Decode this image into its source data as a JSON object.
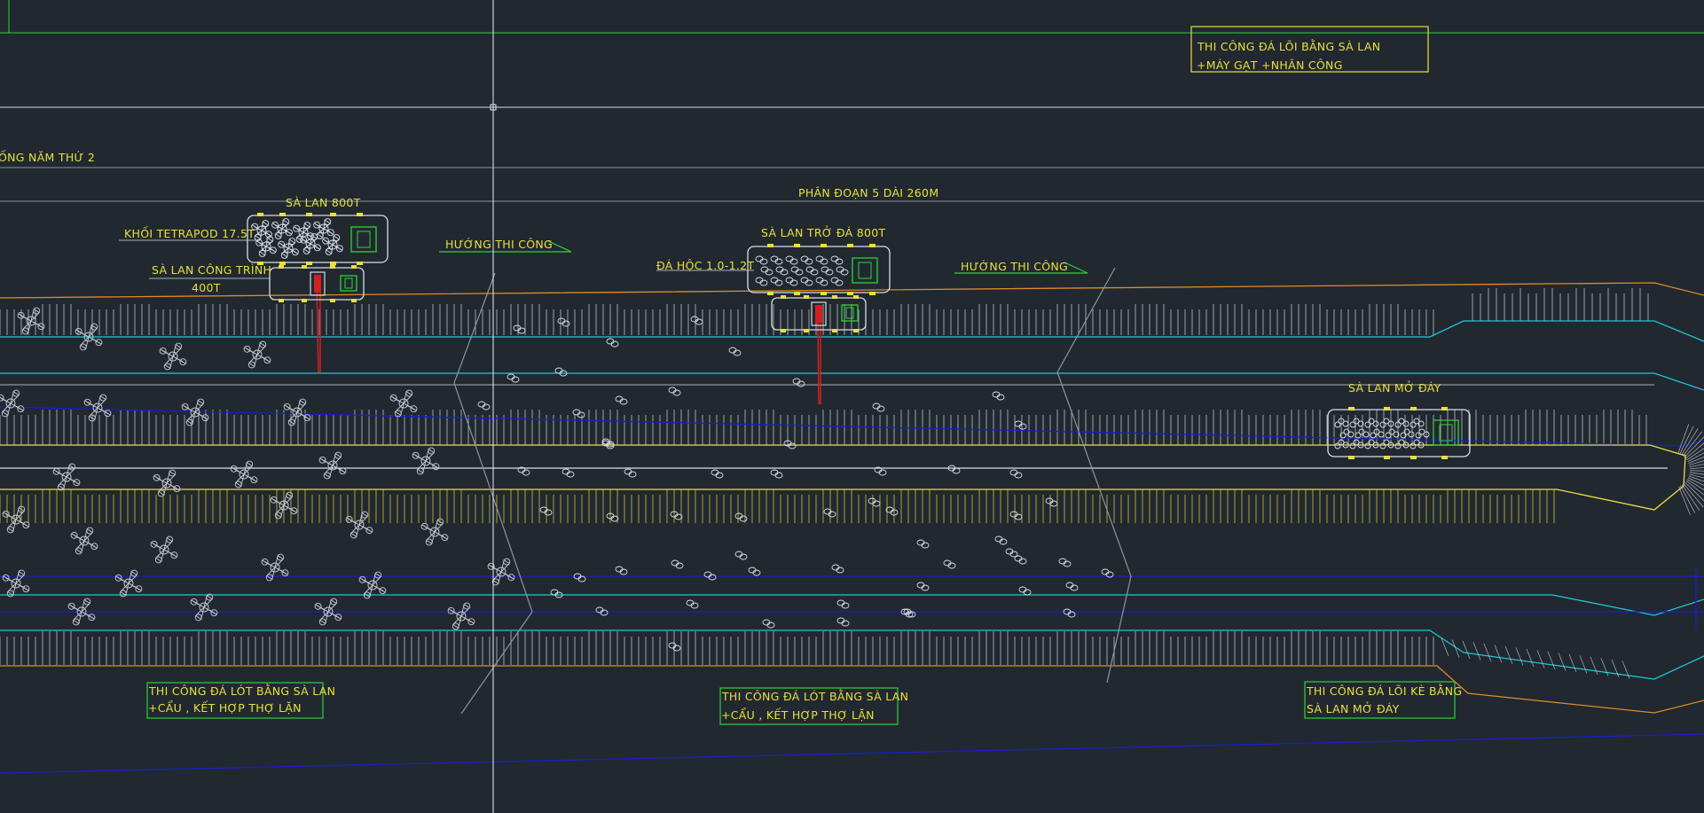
{
  "colors": {
    "background": "#212830",
    "text": "#e8e03c",
    "green": "#2fd23a",
    "cyan": "#1fc8d2",
    "blue": "#1a1ec8",
    "orange": "#e08a28",
    "white": "#d8dde4",
    "grey": "#8f959c",
    "yellow": "#e8e03c",
    "red": "#d02020"
  },
  "labels": {
    "year2": "ỐNG NĂM THỨ 2",
    "phan_doan": "PHÂN ĐOẠN 5 DÀI 260M",
    "barge_800t": "SÀ LAN 800T",
    "tetrapod": "KHỐI TETRAPOD  17.5T",
    "work_barge": "SÀ LAN CÔNG TRÌNH",
    "work_barge_ton": "400T",
    "direction_1": "HƯỚNG THI CÔNG",
    "stone_barge": "SÀ LAN TRỞ ĐÁ 800T",
    "stone_size": "ĐÁ HỘC 1.0-1.2T",
    "direction_2": "HƯỚNG THI CÔNG",
    "dump_barge": "SÀ LAN MỞ ĐÁY"
  },
  "notes": {
    "top_right": {
      "line1": "THI CÔNG ĐÁ LÕI BẰNG SÀ LAN",
      "line2": "+MÁY GẠT +NHÂN CÔNG"
    },
    "bottom_left": {
      "line1": "THI CÔNG ĐÁ LÓT BẰNG SÀ LAN",
      "line2": "+CẨU , KẾT HỢP THỢ LẶN"
    },
    "bottom_mid": {
      "line1": "THI CÔNG ĐÁ LÓT BẰNG SÀ LAN",
      "line2": "+CẨU , KẾT HỢP THỢ LẶN"
    },
    "bottom_right": {
      "line1": "THI CÔNG ĐÁ LÕI KÈ BẰNG",
      "line2": "SÀ LAN MỞ ĐÁY"
    }
  }
}
